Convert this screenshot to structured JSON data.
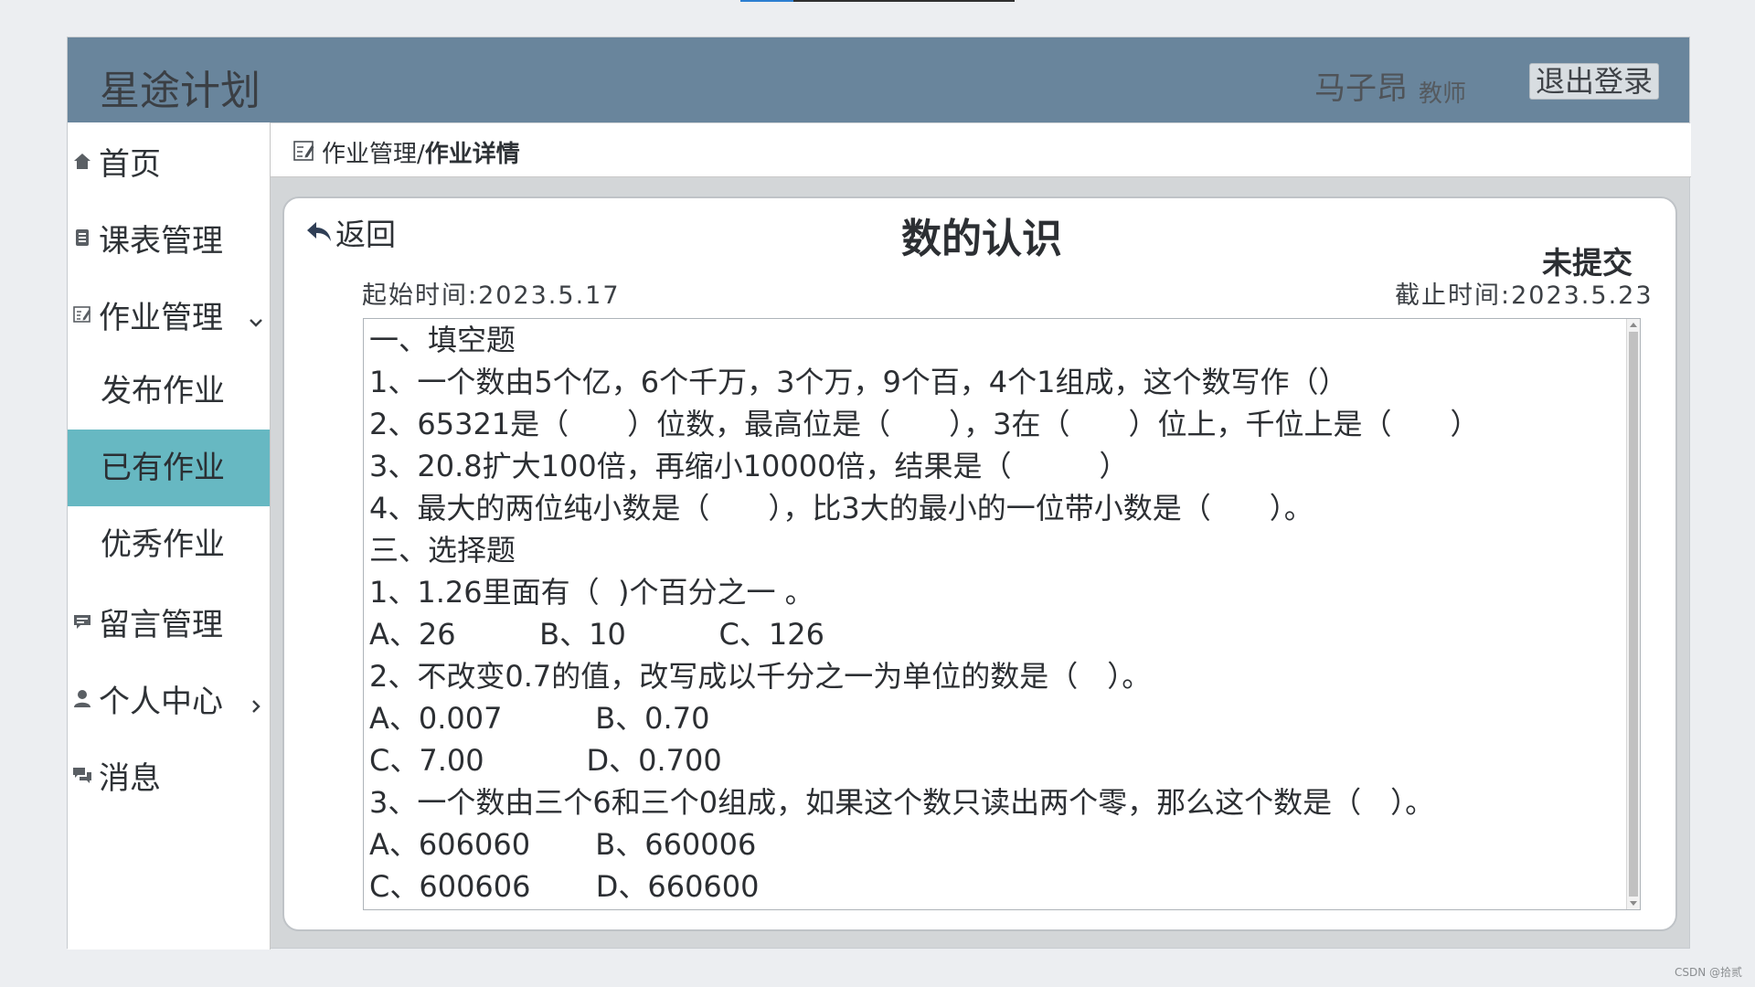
{
  "app": {
    "brand": "星途计划"
  },
  "user": {
    "name": "马子昂",
    "role": "教师",
    "logout_label": "退出登录"
  },
  "sidebar": {
    "home": "首页",
    "schedule": "课表管理",
    "homework": "作业管理",
    "publish": "发布作业",
    "existing": "已有作业",
    "excellent": "优秀作业",
    "messages_mgmt": "留言管理",
    "personal": "个人中心",
    "notifications": "消息"
  },
  "breadcrumb": {
    "parent": "作业管理",
    "separator": "/",
    "current": "作业详情"
  },
  "detail": {
    "back_label": "返回",
    "title": "数的认识",
    "status": "未提交",
    "start_time": "起始时间:2023.5.17",
    "end_time": "截止时间:2023.5.23",
    "content_lines": [
      "一、填空题",
      "1、一个数由5个亿，6个千万，3个万，9个百，4个1组成，这个数写作（）",
      "2、65321是（　　）位数，最高位是（　　），3在（　　）位上，千位上是（　　）",
      "3、20.8扩大100倍，再缩小10000倍，结果是（　　　）",
      "4、最大的两位纯小数是（　　），比3大的最小的一位带小数是（　　）。",
      "三、选择题",
      "1、1.26里面有（  )个百分之一 。",
      "A、26         B、10          C、126",
      "2、不改变0.7的值，改写成以千分之一为单位的数是（　）。",
      "A、0.007          B、0.70",
      "C、7.00           D、0.700",
      "3、一个数由三个6和三个0组成，如果这个数只读出两个零，那么这个数是（　）。",
      "A、606060       B、660006",
      "C、600606       D、660600"
    ]
  },
  "watermark": "CSDN @拾贰"
}
